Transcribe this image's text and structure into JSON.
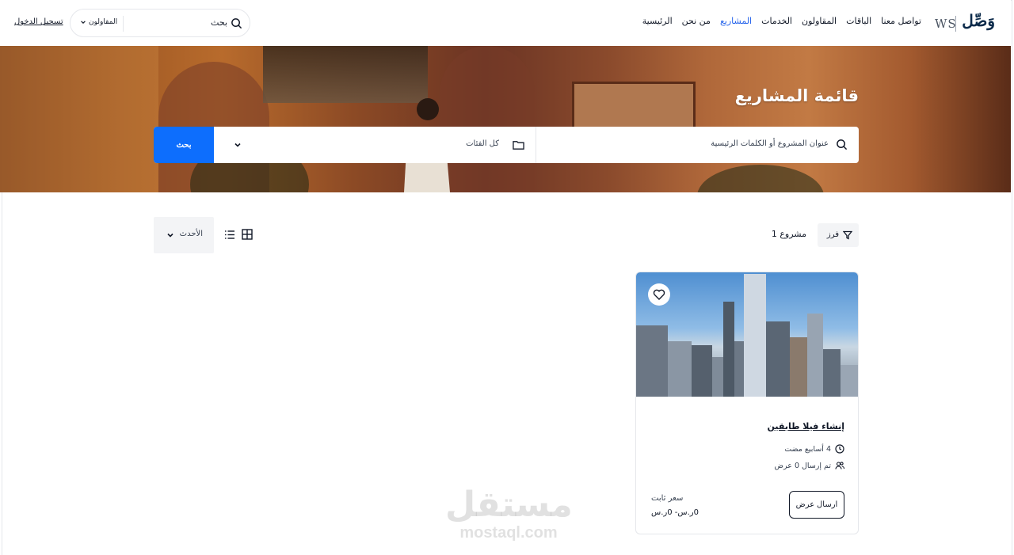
{
  "header": {
    "logo_ar": "وَصِّل",
    "logo_latin": "WS",
    "nav": [
      {
        "label": "الرئيسية",
        "active": false
      },
      {
        "label": "من نحن",
        "active": false
      },
      {
        "label": "المشاريع",
        "active": true
      },
      {
        "label": "الخدمات",
        "active": false
      },
      {
        "label": "المقاولون",
        "active": false
      },
      {
        "label": "الباقات",
        "active": false
      },
      {
        "label": "تواصل معنا",
        "active": false
      }
    ],
    "search_label": "بحث",
    "search_category": "المقاولون",
    "login": "تسجيل الدخول"
  },
  "hero": {
    "title": "قائمة المشاريع",
    "keyword_placeholder": "عنوان المشروع أو الكلمات الرئيسية",
    "category_placeholder": "كل الفئات",
    "search_button": "بحث"
  },
  "toolbar": {
    "filter_label": "فرز",
    "count": "مشروع 1",
    "sort_label": "الأحدث"
  },
  "projects": [
    {
      "title": "إنشاء فيلا طابقين",
      "posted": "4 أسابيع مضت",
      "offers": "تم إرسال 0 عرض",
      "price_type": "سعر ثابت",
      "price_range": "0ر.س- 0ر.س",
      "action": "ارسال عرض"
    }
  ],
  "watermark": {
    "ar": "مستقل",
    "en": "mostaql.com"
  },
  "colors": {
    "accent": "#0d6efd",
    "nav_active": "#2563eb"
  }
}
